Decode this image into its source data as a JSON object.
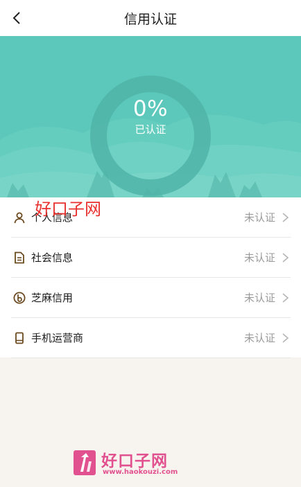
{
  "header": {
    "title": "信用认证"
  },
  "progress": {
    "percent_text": "0%",
    "label": "已认证",
    "value": 0
  },
  "items": [
    {
      "label": "个人信息",
      "status": "未认证",
      "icon": "person-icon"
    },
    {
      "label": "社会信息",
      "status": "未认证",
      "icon": "document-icon"
    },
    {
      "label": "芝麻信用",
      "status": "未认证",
      "icon": "sesame-icon"
    },
    {
      "label": "手机运营商",
      "status": "未认证",
      "icon": "phone-icon"
    }
  ],
  "watermark": {
    "top_text": "好口子网",
    "brand": "好口子网",
    "url": "www.haokouzi.com"
  },
  "colors": {
    "accent": "#5cc8bb",
    "icon": "#6b4a1f",
    "watermark_red": "#e8312f",
    "watermark_pink": "#e2518f"
  }
}
